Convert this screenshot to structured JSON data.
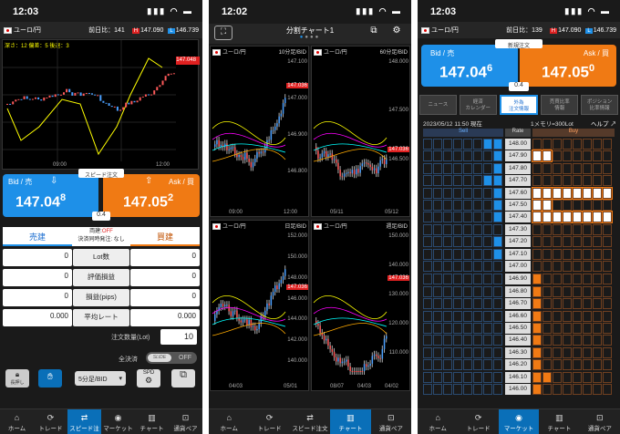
{
  "p1": {
    "time": "12:03",
    "pair": "ユーロ/円",
    "prev": "前日比：141",
    "high": "147.090",
    "low": "146.739",
    "high_tag": "H",
    "low_tag": "L",
    "chart_note": "深さ：12 偏差：5 後退：3",
    "chart_price": "147.048",
    "x1": "09:00",
    "x2": "12:00",
    "bid_label": "Bid / 売",
    "ask_label": "Ask / 買",
    "bid_main": "147.04",
    "bid_last": "8",
    "ask_main": "147.05",
    "ask_last": "2",
    "spread": "0.4",
    "speed": "スピード注文",
    "sell": "売建",
    "buy": "買建",
    "ryodate": "両建:",
    "ryodate_val": "OFF",
    "kessai": "決済同時発注: なし",
    "rows": [
      {
        "l": "0",
        "c": "Lot数",
        "r": "0"
      },
      {
        "l": "0",
        "c": "評価損益",
        "r": "0"
      },
      {
        "l": "0",
        "c": "損益(pips)",
        "r": "0"
      },
      {
        "l": "0.000",
        "c": "平均レート",
        "r": "0.000"
      }
    ],
    "qty_label": "注文数量(Lot)",
    "qty": "10",
    "settle": "全決済",
    "slide": "SLIDE",
    "off": "OFF",
    "btn1": "長押し",
    "select": "5分足/BID",
    "spd": "SPD"
  },
  "p2": {
    "time": "12:02",
    "title": "分割チャート1",
    "pair": "ユーロ/円",
    "c1_tf": "10分足/BID",
    "c2_tf": "60分足/BID",
    "c3_tf": "日足/BID",
    "c4_tf": "週足/BID",
    "c1_y": [
      "147.100",
      "147.000",
      "146.900",
      "146.800"
    ],
    "c1_x": [
      "09:00",
      "12:00"
    ],
    "c2_y": [
      "148.000",
      "147.500",
      "146.500"
    ],
    "c2_x": [
      "05/11",
      "05/12"
    ],
    "c3_y": [
      "152.000",
      "150.000",
      "148.000",
      "146.000",
      "144.000",
      "142.000",
      "140.000"
    ],
    "c3_x": [
      "04/03",
      "05/01"
    ],
    "c4_y": [
      "150.000",
      "140.000",
      "130.000",
      "120.000",
      "110.000"
    ],
    "c4_x": [
      "08/07",
      "04/03",
      "04/02"
    ],
    "price": "147.036"
  },
  "p3": {
    "time": "12:03",
    "pair": "ユーロ/円",
    "prev": "前日比：139",
    "high": "147.090",
    "low": "146.739",
    "high_tag": "H",
    "low_tag": "L",
    "new_order": "新規注文",
    "bid_label": "Bid / 売",
    "ask_label": "Ask / 買",
    "bid_main": "147.04",
    "bid_last": "6",
    "ask_main": "147.05",
    "ask_last": "0",
    "spread": "0.4",
    "tabs": [
      "ニュース",
      "経済\nカレンダー",
      "外為\n注文情報",
      "売買比率\n情報",
      "ポジション\n比率情報"
    ],
    "date": "2023/05/12 11:50 現在",
    "unit": "1メモリ=300Lot",
    "help": "ヘルプ",
    "sell_h": "Sell",
    "rate_h": "Rate",
    "buy_h": "Buy",
    "rates": [
      "148.00",
      "147.90",
      "147.80",
      "147.70",
      "147.60",
      "147.50",
      "147.40",
      "147.30",
      "147.20",
      "147.10",
      "147.00",
      "146.90",
      "146.80",
      "146.70",
      "146.60",
      "146.50",
      "146.40",
      "146.30",
      "146.20",
      "146.10",
      "146.00"
    ],
    "sell": [
      2,
      1,
      1,
      2,
      1,
      1,
      1,
      0,
      1,
      1,
      0,
      0,
      0,
      0,
      0,
      0,
      0,
      0,
      0,
      0,
      0
    ],
    "buy": [
      0,
      2,
      0,
      0,
      8,
      2,
      8,
      0,
      0,
      0,
      0,
      1,
      1,
      1,
      1,
      1,
      1,
      1,
      1,
      2,
      1
    ]
  },
  "tabs1": [
    "ホーム",
    "トレード",
    "スピード注文",
    "マーケット",
    "チャート",
    "通貨ペア"
  ],
  "tabs2": [
    "ホーム",
    "トレード",
    "スピード注文",
    "チャート",
    "通貨ペア"
  ],
  "tabs3": [
    "ホーム",
    "トレード",
    "マーケット",
    "チャート",
    "通貨ペア"
  ],
  "colors": {
    "blue": "#1e90e8",
    "orange": "#f07a14",
    "active": "#0a6fb8",
    "red": "#e02020"
  }
}
